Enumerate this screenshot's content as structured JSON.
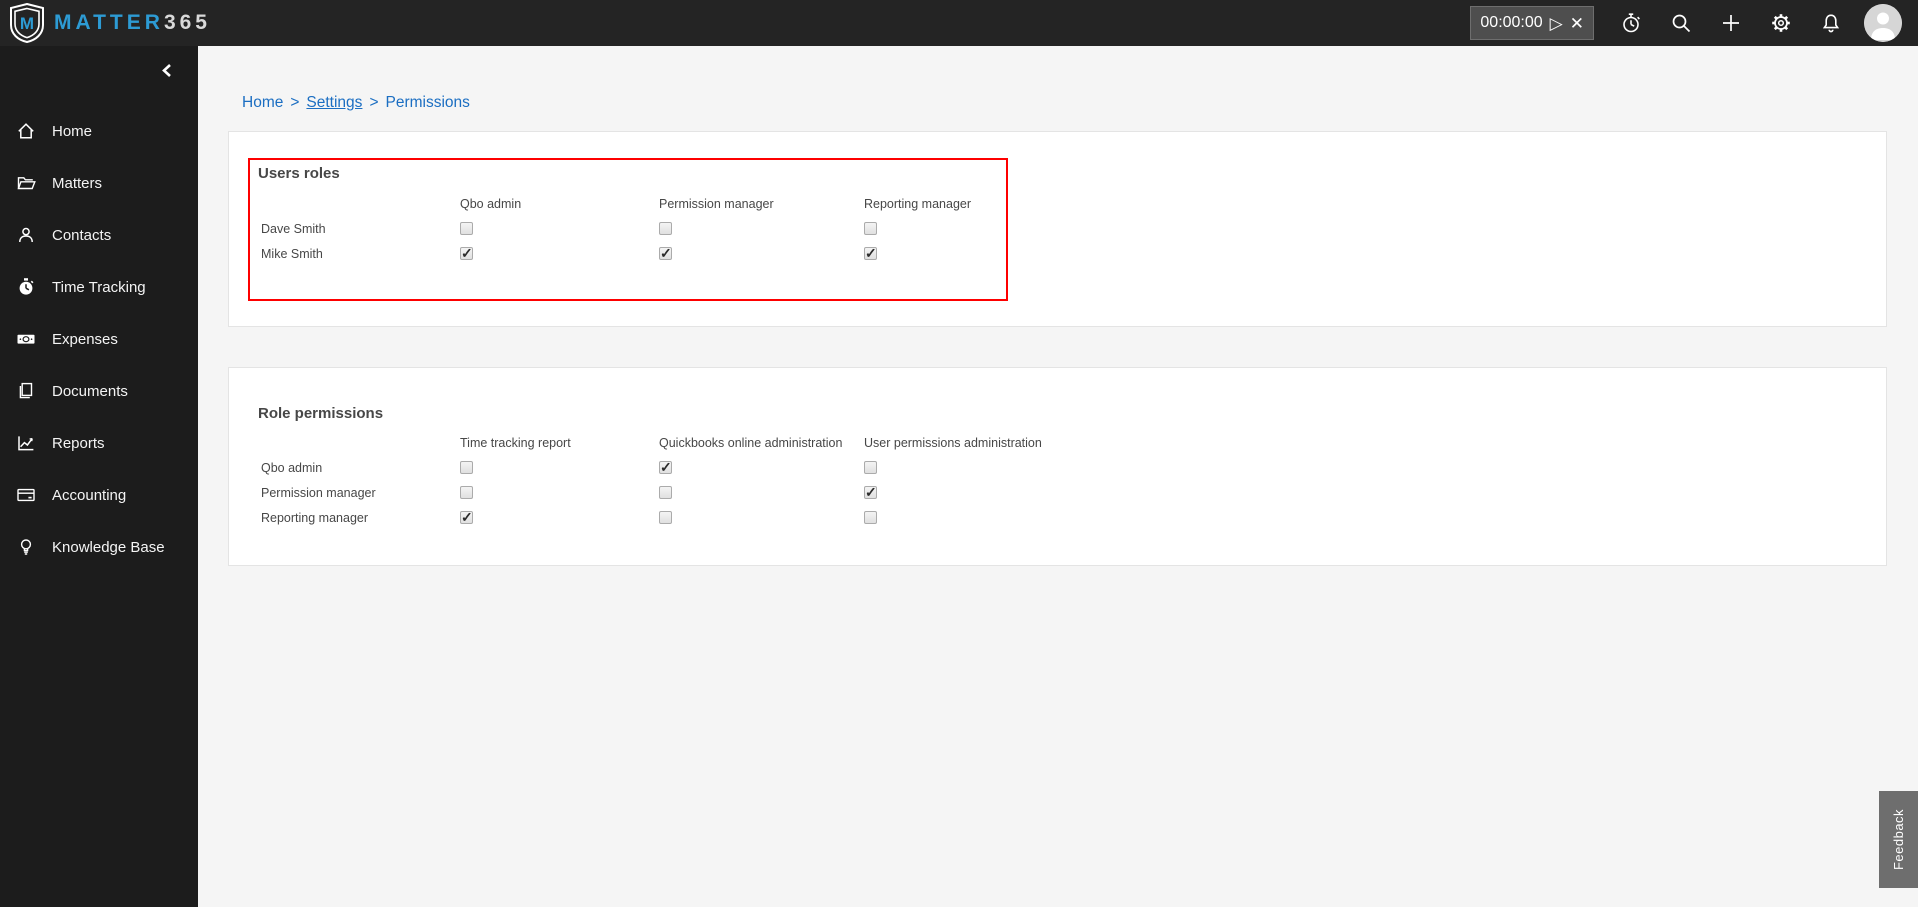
{
  "app": {
    "title": "MATTER365"
  },
  "topbar": {
    "brand": {
      "name_primary": "MATTER",
      "name_suffix": "365"
    },
    "timer": {
      "value": "00:00:00",
      "play_glyph": "▷",
      "close_glyph": "✕"
    },
    "icons": [
      "stopwatch-icon",
      "search-icon",
      "add-icon",
      "settings-gear-icon",
      "notifications-bell-icon",
      "user-avatar"
    ]
  },
  "sidebar": {
    "collapse_icon": "chevron-left-icon",
    "items": [
      {
        "label": "Home",
        "icon": "home-icon"
      },
      {
        "label": "Matters",
        "icon": "folder-icon"
      },
      {
        "label": "Contacts",
        "icon": "person-icon"
      },
      {
        "label": "Time Tracking",
        "icon": "stopwatch-filled-icon"
      },
      {
        "label": "Expenses",
        "icon": "banknote-icon"
      },
      {
        "label": "Documents",
        "icon": "documents-icon"
      },
      {
        "label": "Reports",
        "icon": "chart-icon"
      },
      {
        "label": "Accounting",
        "icon": "credit-card-icon"
      },
      {
        "label": "Knowledge Base",
        "icon": "lightbulb-icon"
      }
    ]
  },
  "breadcrumb": {
    "separator": ">",
    "items": [
      {
        "label": "Home",
        "underline": false,
        "current": false
      },
      {
        "label": "Settings",
        "underline": true,
        "current": false
      },
      {
        "label": "Permissions",
        "underline": false,
        "current": true
      }
    ]
  },
  "users_roles": {
    "title": "Users roles",
    "columns": [
      "Qbo admin",
      "Permission manager",
      "Reporting manager"
    ],
    "rows": [
      {
        "name": "Dave Smith",
        "checks": [
          false,
          false,
          false
        ]
      },
      {
        "name": "Mike Smith",
        "checks": [
          true,
          true,
          true
        ]
      }
    ]
  },
  "role_permissions": {
    "title": "Role permissions",
    "columns": [
      "Time tracking report",
      "Quickbooks online administration",
      "User permissions administration"
    ],
    "rows": [
      {
        "name": "Qbo admin",
        "checks": [
          false,
          true,
          false
        ]
      },
      {
        "name": "Permission manager",
        "checks": [
          false,
          false,
          true
        ]
      },
      {
        "name": "Reporting manager",
        "checks": [
          true,
          false,
          false
        ]
      }
    ]
  },
  "feedback": {
    "label": "Feedback"
  },
  "colors": {
    "brand_blue": "#2d9bd4",
    "breadcrumb_blue": "#1b6ec2",
    "highlight_red": "#fe0000",
    "topbar_bg": "#242424",
    "sidebar_bg": "#1c1c1c",
    "feedback_bg": "#6e6e6e"
  }
}
